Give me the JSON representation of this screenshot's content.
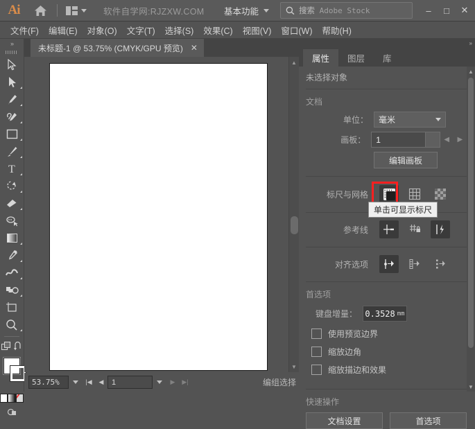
{
  "topbar": {
    "logo": "Ai",
    "home_icon": "home-icon",
    "arrange_icon": "arrange-documents-icon",
    "site_text": "软件自学网:RJZXW.COM",
    "workspace": "基本功能",
    "search_placeholder_cn": "搜索",
    "search_placeholder_en": "Adobe Stock",
    "window_buttons": [
      "–",
      "□",
      "✕"
    ]
  },
  "menubar": {
    "items": [
      "文件(F)",
      "编辑(E)",
      "对象(O)",
      "文字(T)",
      "选择(S)",
      "效果(C)",
      "视图(V)",
      "窗口(W)",
      "帮助(H)"
    ]
  },
  "toolbar": {
    "collapse": "»",
    "tools": [
      {
        "name": "selection-tool"
      },
      {
        "name": "direct-selection-tool"
      },
      {
        "name": "pen-tool"
      },
      {
        "name": "curvature-tool"
      },
      {
        "name": "rectangle-tool"
      },
      {
        "name": "paintbrush-tool"
      },
      {
        "name": "type-tool"
      },
      {
        "name": "rotate-tool"
      },
      {
        "name": "eraser-tool"
      },
      {
        "name": "lasso-tool"
      },
      {
        "name": "gradient-tool"
      },
      {
        "name": "eyedropper-tool"
      },
      {
        "name": "width-tool"
      },
      {
        "name": "shape-builder-tool"
      },
      {
        "name": "artboard-tool"
      },
      {
        "name": "zoom-tool"
      }
    ]
  },
  "document_tab": {
    "title": "未标题-1 @ 53.75% (CMYK/GPU 预览)",
    "close": "✕"
  },
  "statusbar": {
    "zoom": "53.75%",
    "page": "1",
    "status_text": "编组选择"
  },
  "panel": {
    "collapse": "»",
    "tabs": [
      {
        "label": "属性",
        "active": true
      },
      {
        "label": "图层",
        "active": false
      },
      {
        "label": "库",
        "active": false
      }
    ],
    "no_selection": "未选择对象",
    "document": {
      "title": "文档",
      "unit_label": "单位：",
      "unit_value": "毫米",
      "artboard_label": "画板：",
      "artboard_value": "1",
      "edit_artboard_button": "编辑画板"
    },
    "rulers_grid": {
      "title": "标尺与网格",
      "icons": [
        "show-rulers-icon",
        "show-grid-icon",
        "show-transparency-grid-icon"
      ],
      "highlight_color": "#ff2020"
    },
    "guides": {
      "title": "参考线",
      "icons": [
        "show-guides-icon",
        "lock-guides-icon",
        "smart-guides-icon"
      ]
    },
    "align": {
      "title": "对齐选项",
      "icons": [
        "snap-to-point-icon",
        "snap-to-grid-icon",
        "snap-to-pixel-icon"
      ]
    },
    "preferences": {
      "title": "首选项",
      "keyboard_increment_label": "键盘增量：",
      "keyboard_increment_value": "0.3528",
      "keyboard_increment_unit": "mm",
      "checkboxes": [
        {
          "label": "使用预览边界",
          "checked": false
        },
        {
          "label": "缩放边角",
          "checked": false
        },
        {
          "label": "缩放描边和效果",
          "checked": false
        }
      ]
    },
    "quick_actions": {
      "title": "快速操作",
      "buttons": [
        "文档设置",
        "首选项"
      ]
    }
  },
  "tooltip": {
    "text": "单击可显示标尺"
  }
}
